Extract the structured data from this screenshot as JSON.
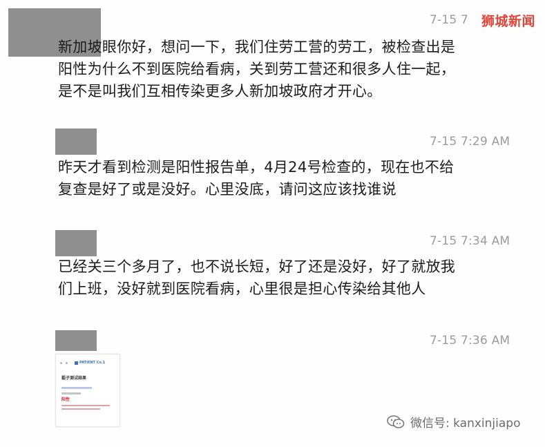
{
  "brand": {
    "name": "狮城新闻"
  },
  "messages": [
    {
      "time": "7-15 7",
      "lines": [
        "新加坡眼你好，想问一下，我们住劳工营的劳工，被检查出是",
        "阳性为什么不到医院给看病，关到劳工营还和很多人住一起，",
        "是不是叫我们互相传染更多人新加坡政府才开心。"
      ]
    },
    {
      "time": "7-15 7:29 AM",
      "lines": [
        "昨天才看到检测是阳性报告单，4月24号检查的，现在也不给",
        "复查是好了或是没好。心里没底，请问这应该找谁说"
      ]
    },
    {
      "time": "7-15 7:34 AM",
      "lines": [
        "已经关三个多月了，也不说长短，好了还是没好，好了就放我",
        "们上班，没好就到医院看病，心里很是担心传染给其他人"
      ]
    },
    {
      "time": "7-15 7:36 AM",
      "attachment": {
        "header": "PATIENT Co.1",
        "title": "鉏子测试结果",
        "result_label": "阳性"
      }
    }
  ],
  "footer": {
    "watermark": "微信号: kanxinjiapo"
  },
  "colors": {
    "brand": "#e0453a",
    "avatar": "#8f8f8f",
    "timestamp": "#9b9b9b",
    "text": "#1c1c1c",
    "positive_red": "#d4282a"
  }
}
